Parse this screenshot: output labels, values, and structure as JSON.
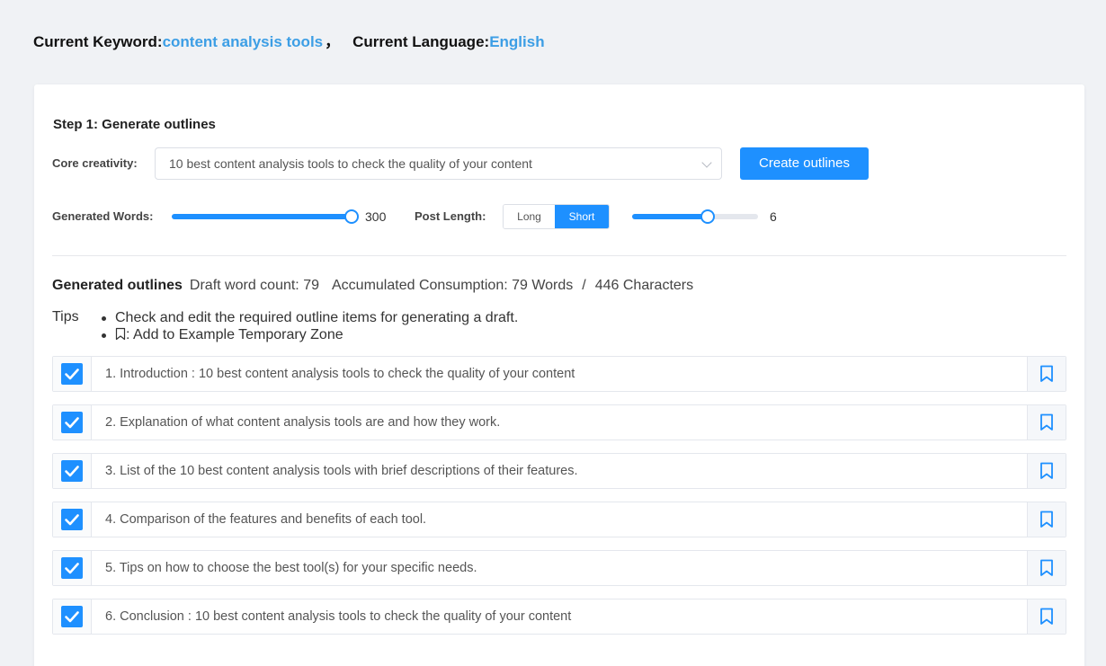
{
  "header": {
    "keyword_label": "Current Keyword:",
    "keyword_value": "content analysis tools",
    "separator": "，",
    "language_label": "Current Language:",
    "language_value": "English"
  },
  "step1": {
    "title": "Step 1: Generate outlines",
    "core_label": "Core creativity:",
    "core_value": "10 best content analysis tools to check the quality of your content",
    "create_button": "Create outlines",
    "words_label": "Generated Words:",
    "words_value": "300",
    "words_fraction": 1.0,
    "length_label": "Post Length:",
    "length_options": [
      "Long",
      "Short"
    ],
    "length_selected": "Short",
    "sections_value": "6",
    "sections_fraction": 0.6
  },
  "outlines": {
    "title": "Generated outlines",
    "draft_word_count": "Draft word count: 79",
    "accumulated": "Accumulated Consumption: 79 Words",
    "slash": "/",
    "characters": "446 Characters",
    "tips_label": "Tips",
    "tips": [
      "Check and edit the required outline items for generating a draft.",
      ": Add to Example Temporary Zone"
    ],
    "items": [
      {
        "text": "1. Introduction : 10 best content analysis tools to check the quality of your content",
        "checked": true
      },
      {
        "text": "2. Explanation of what content analysis tools are and how they work.",
        "checked": true
      },
      {
        "text": "3. List of the 10 best content analysis tools with brief descriptions of their features.",
        "checked": true
      },
      {
        "text": "4. Comparison of the features and benefits of each tool.",
        "checked": true
      },
      {
        "text": "5. Tips on how to choose the best tool(s) for your specific needs.",
        "checked": true
      },
      {
        "text": "6. Conclusion : 10 best content analysis tools to check the quality of your content",
        "checked": true
      }
    ]
  },
  "colors": {
    "accent": "#1e90ff",
    "keyword": "#3c9ee5",
    "background": "#f0f2f5"
  }
}
